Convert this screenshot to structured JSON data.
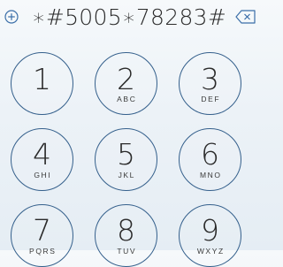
{
  "entry": {
    "dialed_number": "∗#5005∗78283#",
    "add_icon": "add-contact-plus-circle",
    "delete_icon": "backspace-delete"
  },
  "keypad": {
    "keys": [
      {
        "digit": "1",
        "letters": ""
      },
      {
        "digit": "2",
        "letters": "ABC"
      },
      {
        "digit": "3",
        "letters": "DEF"
      },
      {
        "digit": "4",
        "letters": "GHI"
      },
      {
        "digit": "5",
        "letters": "JKL"
      },
      {
        "digit": "6",
        "letters": "MNO"
      },
      {
        "digit": "7",
        "letters": "PQRS"
      },
      {
        "digit": "8",
        "letters": "TUV"
      },
      {
        "digit": "9",
        "letters": "WXYZ"
      }
    ]
  },
  "colors": {
    "key_ring": "#35608c",
    "icon": "#3a6ea8",
    "text": "#2a2a2a",
    "background": "#eef3f8"
  }
}
